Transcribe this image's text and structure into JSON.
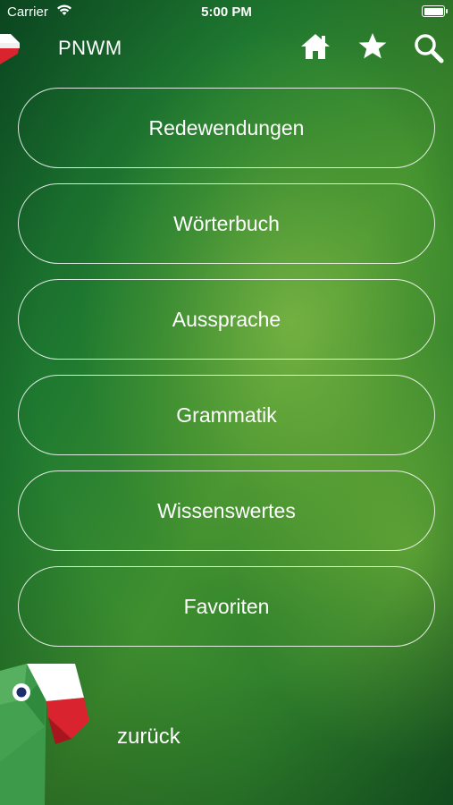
{
  "status_bar": {
    "carrier": "Carrier",
    "time": "5:00 PM",
    "icons": [
      "wifi-icon",
      "battery-icon"
    ]
  },
  "nav": {
    "title": "PNWM",
    "icons": [
      "home-icon",
      "star-icon",
      "search-icon"
    ]
  },
  "menu": {
    "items": [
      {
        "label": "Redewendungen"
      },
      {
        "label": "Wörterbuch"
      },
      {
        "label": "Aussprache"
      },
      {
        "label": "Grammatik"
      },
      {
        "label": "Wissenswertes"
      },
      {
        "label": "Favoriten"
      }
    ]
  },
  "footer": {
    "back_label": "zurück"
  },
  "colors": {
    "background_dark": "#0f5428",
    "background_light": "#8cc43c",
    "flag_red": "#d9232e",
    "flag_white": "#ffffff",
    "mascot_green": "#3d9a4a"
  }
}
